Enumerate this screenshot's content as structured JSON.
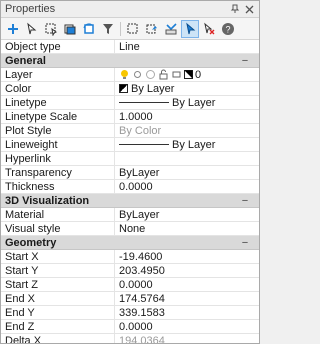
{
  "panel": {
    "title": "Properties"
  },
  "colors": {
    "section_bg": "#d9d9d9",
    "accent": "#1e7fd6",
    "dim_text": "#9a9a9a"
  },
  "toolbar": {
    "icons": [
      "add-selection-icon",
      "select-icon",
      "window-select-icon",
      "select-similar-icon",
      "reselect-icon",
      "filter-icon",
      "quick-select-icon",
      "pick-add-icon",
      "toggle-pickadd-icon",
      "deselect-icon",
      "help-icon"
    ]
  },
  "object_type": {
    "label": "Object type",
    "value": "Line"
  },
  "general": {
    "title": "General",
    "collapse": "−",
    "layer": {
      "label": "Layer",
      "value": "0"
    },
    "color": {
      "label": "Color",
      "value": "By Layer"
    },
    "linetype": {
      "label": "Linetype",
      "value": "By Layer"
    },
    "linetype_scale": {
      "label": "Linetype Scale",
      "value": "1.0000"
    },
    "plot_style": {
      "label": "Plot Style",
      "value": "By Color"
    },
    "lineweight": {
      "label": "Lineweight",
      "value": "By Layer"
    },
    "hyperlink": {
      "label": "Hyperlink",
      "value": ""
    },
    "transparency": {
      "label": "Transparency",
      "value": "ByLayer"
    },
    "thickness": {
      "label": "Thickness",
      "value": "0.0000"
    }
  },
  "viz3d": {
    "title": "3D Visualization",
    "collapse": "−",
    "material": {
      "label": "Material",
      "value": "ByLayer"
    },
    "visual_style": {
      "label": "Visual style",
      "value": "None"
    }
  },
  "geometry": {
    "title": "Geometry",
    "collapse": "−",
    "start_x": {
      "label": "Start X",
      "value": "-19.4600"
    },
    "start_y": {
      "label": "Start Y",
      "value": "203.4950"
    },
    "start_z": {
      "label": "Start Z",
      "value": "0.0000"
    },
    "end_x": {
      "label": "End X",
      "value": "174.5764"
    },
    "end_y": {
      "label": "End Y",
      "value": "339.1583"
    },
    "end_z": {
      "label": "End Z",
      "value": "0.0000"
    },
    "delta_x": {
      "label": "Delta X",
      "value": "194.0364"
    }
  }
}
